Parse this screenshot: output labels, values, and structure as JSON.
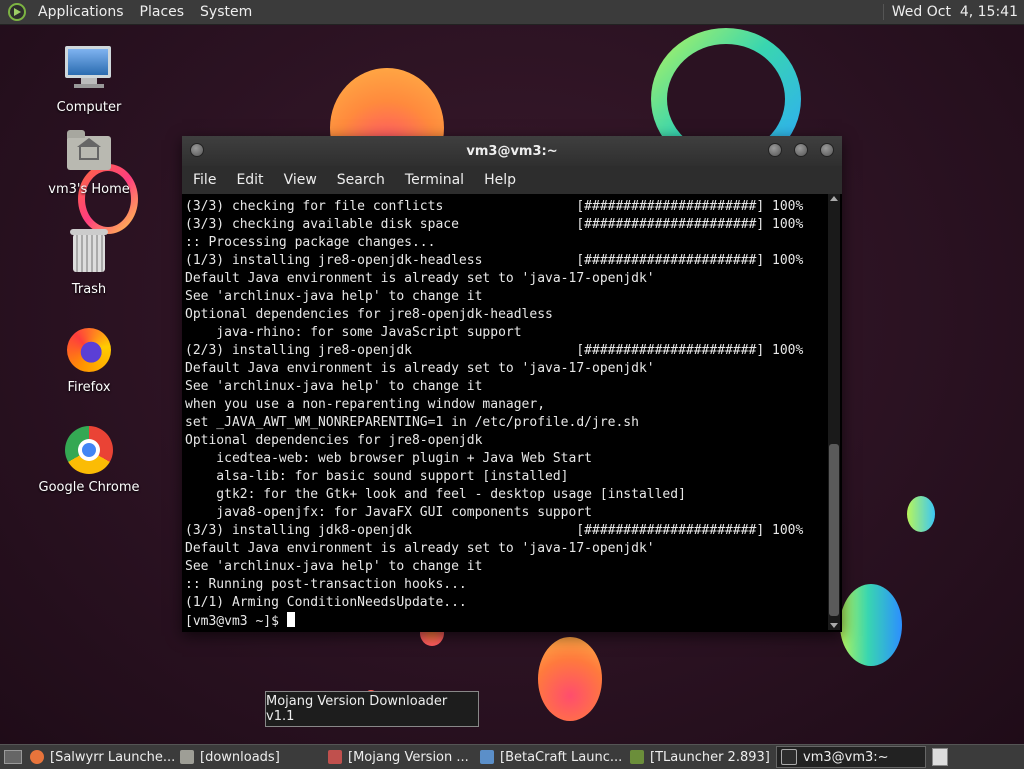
{
  "top_panel": {
    "menus": [
      "Applications",
      "Places",
      "System"
    ],
    "clock": "Wed Oct  4, 15:41"
  },
  "desktop_icons": [
    {
      "label": "Computer",
      "icon": "computer-icon"
    },
    {
      "label": "vm3's Home",
      "icon": "home-folder-icon"
    },
    {
      "label": "Trash",
      "icon": "trash-icon"
    },
    {
      "label": "Firefox",
      "icon": "firefox-icon"
    },
    {
      "label": "Google Chrome",
      "icon": "chrome-icon"
    }
  ],
  "terminal": {
    "title": "vm3@vm3:~",
    "menus": [
      "File",
      "Edit",
      "View",
      "Search",
      "Terminal",
      "Help"
    ],
    "lines": [
      "(3/3) checking for file conflicts                 [######################] 100%",
      "(3/3) checking available disk space               [######################] 100%",
      ":: Processing package changes...",
      "(1/3) installing jre8-openjdk-headless            [######################] 100%",
      "Default Java environment is already set to 'java-17-openjdk'",
      "See 'archlinux-java help' to change it",
      "Optional dependencies for jre8-openjdk-headless",
      "    java-rhino: for some JavaScript support",
      "(2/3) installing jre8-openjdk                     [######################] 100%",
      "Default Java environment is already set to 'java-17-openjdk'",
      "See 'archlinux-java help' to change it",
      "when you use a non-reparenting window manager,",
      "set _JAVA_AWT_WM_NONREPARENTING=1 in /etc/profile.d/jre.sh",
      "Optional dependencies for jre8-openjdk",
      "    icedtea-web: web browser plugin + Java Web Start",
      "    alsa-lib: for basic sound support [installed]",
      "    gtk2: for the Gtk+ look and feel - desktop usage [installed]",
      "    java8-openjfx: for JavaFX GUI components support",
      "(3/3) installing jdk8-openjdk                     [######################] 100%",
      "Default Java environment is already set to 'java-17-openjdk'",
      "See 'archlinux-java help' to change it",
      ":: Running post-transaction hooks...",
      "(1/1) Arming ConditionNeedsUpdate..."
    ],
    "prompt": "[vm3@vm3 ~]$ "
  },
  "tooltip": "Mojang Version Downloader v1.1",
  "taskbar": {
    "tasks": [
      {
        "label": "[Salwyrr Launche...",
        "icon": "firefox-icon",
        "color": "#e8743b",
        "active": false
      },
      {
        "label": "[downloads]",
        "icon": "folder-icon",
        "color": "#9e9e96",
        "active": false
      },
      {
        "label": "[Mojang Version ...",
        "icon": "java-icon",
        "color": "#c0504d",
        "active": false
      },
      {
        "label": "[BetaCraft Launc...",
        "icon": "java-icon",
        "color": "#5b8fc9",
        "active": false
      },
      {
        "label": "[TLauncher 2.893]",
        "icon": "tlauncher-icon",
        "color": "#6b8e3a",
        "active": false
      },
      {
        "label": "vm3@vm3:~",
        "icon": "terminal-icon",
        "color": "#2d2d2d",
        "active": true
      }
    ]
  }
}
